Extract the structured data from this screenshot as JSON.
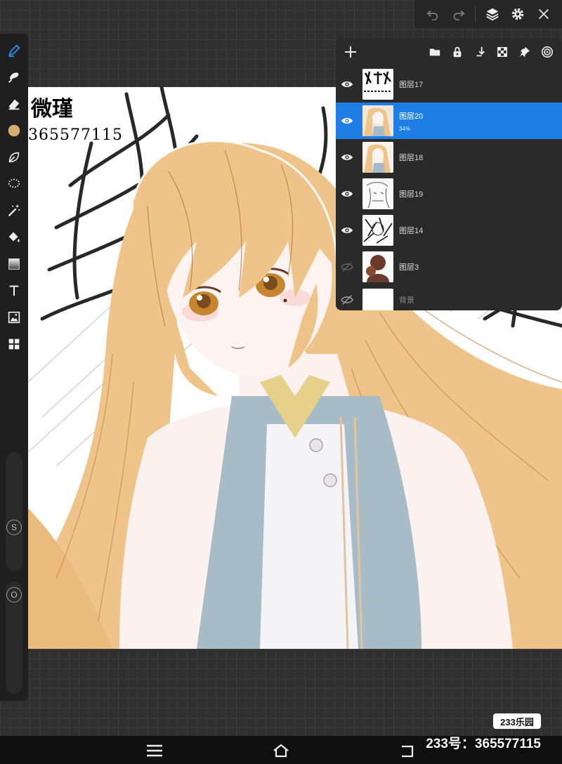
{
  "toolbar": {
    "undo_icon": "undo-icon",
    "redo_icon": "redo-icon",
    "layers_icon": "layers-icon",
    "settings_icon": "gear-icon",
    "close_icon": "close-icon"
  },
  "left_tools": [
    {
      "name": "pen-tool",
      "icon": "pen-icon",
      "active": true
    },
    {
      "name": "smudge-tool",
      "icon": "smudge-icon"
    },
    {
      "name": "eraser-tool",
      "icon": "eraser-icon"
    },
    {
      "name": "color-picker",
      "icon": "color-swatch-icon",
      "color": "#d6ac73"
    },
    {
      "name": "leaf-brush",
      "icon": "leaf-icon"
    },
    {
      "name": "lasso-tool",
      "icon": "lasso-icon"
    },
    {
      "name": "magic-wand",
      "icon": "magic-wand-icon"
    },
    {
      "name": "fill-tool",
      "icon": "paint-bucket-icon"
    },
    {
      "name": "gradient-tool",
      "icon": "gradient-icon"
    },
    {
      "name": "text-tool",
      "icon": "text-icon"
    },
    {
      "name": "image-tool",
      "icon": "image-icon"
    },
    {
      "name": "more-tools",
      "icon": "grid-icon"
    }
  ],
  "sliders": {
    "size_badge": "S",
    "opacity_badge": "O"
  },
  "canvas": {
    "watermark_title": "微瑾",
    "watermark_number": "365577115"
  },
  "layers_panel": {
    "header_icons": [
      "add-layer-icon",
      "folder-icon",
      "lock-icon",
      "merge-down-icon",
      "checker-icon",
      "pin-icon",
      "target-icon"
    ],
    "layers": [
      {
        "name": "图层17",
        "visible": true,
        "selected": false,
        "opacity": ""
      },
      {
        "name": "图层20",
        "visible": true,
        "selected": true,
        "opacity": "34%"
      },
      {
        "name": "图层18",
        "visible": true,
        "selected": false,
        "opacity": ""
      },
      {
        "name": "图层19",
        "visible": true,
        "selected": false,
        "opacity": ""
      },
      {
        "name": "图层14",
        "visible": true,
        "selected": false,
        "opacity": ""
      },
      {
        "name": "图层3",
        "visible": false,
        "selected": false,
        "opacity": ""
      },
      {
        "name": "背景",
        "visible": false,
        "selected": false,
        "opacity": ""
      }
    ]
  },
  "bottom": {
    "site_badge": "233乐园",
    "qq_text": "233号：365577115"
  },
  "colors": {
    "hair": "#eec48a",
    "accent_blue": "#1e7ee6",
    "dress_blue": "#a7bcc6"
  }
}
